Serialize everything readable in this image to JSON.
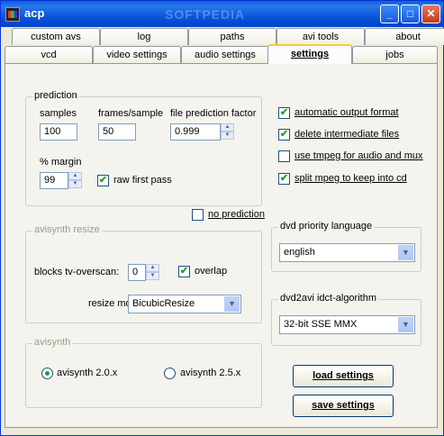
{
  "window": {
    "title": "acp",
    "watermark": "SOFTPEDIA"
  },
  "tabs_row1": [
    "custom avs",
    "log",
    "paths",
    "avi tools",
    "about"
  ],
  "tabs_row2": [
    "vcd",
    "video settings",
    "audio settings",
    "settings",
    "jobs"
  ],
  "active_tab": "settings",
  "prediction": {
    "legend": "prediction",
    "samples_label": "samples",
    "samples_value": "100",
    "frames_label": "frames/sample",
    "frames_value": "50",
    "factor_label": "file prediction factor",
    "factor_value": "0.999",
    "margin_label": "% margin",
    "margin_value": "99",
    "raw_first_pass_label": "raw first pass",
    "raw_first_pass_checked": true
  },
  "no_prediction": {
    "label": "no prediction",
    "checked": false
  },
  "avisynth_resize": {
    "legend": "avisynth resize",
    "overscan_label": "blocks tv-overscan:",
    "overscan_value": "0",
    "overlap_label": "overlap",
    "overlap_checked": true,
    "mode_label": "resize mode:",
    "mode_value": "BicubicResize"
  },
  "avisynth": {
    "legend": "avisynth",
    "option1": "avisynth  2.0.x",
    "option2": "avisynth  2.5.x",
    "selected": "2.0.x"
  },
  "options": [
    {
      "label": "automatic output format",
      "checked": true
    },
    {
      "label": "delete intermediate files",
      "checked": true
    },
    {
      "label": "use tmpeg for audio and mux",
      "checked": false
    },
    {
      "label": "split mpeg to keep into cd",
      "checked": true
    }
  ],
  "dvd_priority": {
    "legend": "dvd priority language",
    "value": "english"
  },
  "dvd2avi": {
    "legend": "dvd2avi  idct-algorithm",
    "value": "32-bit SSE MMX"
  },
  "buttons": {
    "load": "load settings",
    "save": "save settings"
  },
  "colors": {
    "titlebar": "#0856dd",
    "accent_tab": "#ffc83c",
    "check": "#21a121"
  }
}
